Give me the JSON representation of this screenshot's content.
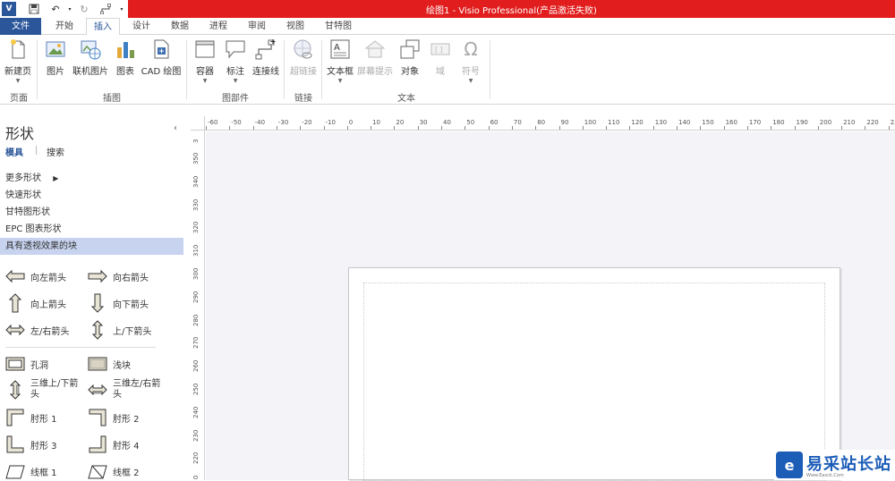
{
  "titlebar": {
    "title": "绘图1 -  Visio Professional(产品激活失败)",
    "app_icon": "V"
  },
  "tabs": [
    {
      "label": "文件"
    },
    {
      "label": "开始"
    },
    {
      "label": "插入"
    },
    {
      "label": "设计"
    },
    {
      "label": "数据"
    },
    {
      "label": "进程"
    },
    {
      "label": "审阅"
    },
    {
      "label": "视图"
    },
    {
      "label": "甘特图"
    }
  ],
  "ribbon": {
    "buttons": [
      {
        "label": "新建页",
        "icon": "new-page-icon"
      },
      {
        "label": "图片",
        "icon": "picture-icon"
      },
      {
        "label": "联机图片",
        "icon": "online-picture-icon"
      },
      {
        "label": "图表",
        "icon": "chart-icon"
      },
      {
        "label": "CAD 绘图",
        "icon": "cad-drawing-icon"
      },
      {
        "label": "容器",
        "icon": "container-icon"
      },
      {
        "label": "标注",
        "icon": "callout-icon"
      },
      {
        "label": "连接线",
        "icon": "connector-icon"
      },
      {
        "label": "超链接",
        "icon": "hyperlink-icon"
      },
      {
        "label": "文本框",
        "icon": "textbox-icon"
      },
      {
        "label": "屏幕提示",
        "icon": "screentip-icon"
      },
      {
        "label": "对象",
        "icon": "object-icon"
      },
      {
        "label": "域",
        "icon": "field-icon"
      },
      {
        "label": "符号",
        "icon": "symbol-icon"
      }
    ],
    "groups": [
      {
        "label": "页面"
      },
      {
        "label": "插图"
      },
      {
        "label": "图部件"
      },
      {
        "label": "链接"
      },
      {
        "label": "文本"
      }
    ]
  },
  "shapes_pane": {
    "title": "形状",
    "subtabs": [
      {
        "label": "模具"
      },
      {
        "label": "搜索"
      }
    ],
    "nav": [
      {
        "label": "更多形状"
      },
      {
        "label": "快速形状"
      },
      {
        "label": "甘特图形状"
      },
      {
        "label": "EPC 图表形状"
      },
      {
        "label": "具有透视效果的块"
      }
    ],
    "shapes": [
      {
        "label": "向左箭头"
      },
      {
        "label": "向右箭头"
      },
      {
        "label": "向上箭头"
      },
      {
        "label": "向下箭头"
      },
      {
        "label": "左/右箭头"
      },
      {
        "label": "上/下箭头"
      },
      {
        "label": "孔洞"
      },
      {
        "label": "浅块"
      },
      {
        "label": "三维上/下箭头"
      },
      {
        "label": "三维左/右箭头"
      },
      {
        "label": "肘形 1"
      },
      {
        "label": "肘形 2"
      },
      {
        "label": "肘形 3"
      },
      {
        "label": "肘形 4"
      },
      {
        "label": "线框 1"
      },
      {
        "label": "线框 2"
      }
    ]
  },
  "rulers": {
    "horizontal": [
      "-60",
      "-50",
      "-40",
      "-30",
      "-20",
      "-10",
      "0",
      "10",
      "20",
      "30",
      "40",
      "50",
      "60",
      "70",
      "80",
      "90",
      "100",
      "110",
      "120",
      "130",
      "140",
      "150",
      "160",
      "170",
      "180",
      "190",
      "200",
      "210",
      "220",
      "23"
    ],
    "vertical": [
      "3",
      "350",
      "340",
      "330",
      "320",
      "310",
      "300",
      "290",
      "280",
      "270",
      "260",
      "250",
      "240",
      "230",
      "220",
      "210"
    ]
  },
  "watermark": {
    "text": "易采站长站",
    "url": "Www.Easck.Com"
  },
  "colors": {
    "title_red": "#e11d1d",
    "file_tab_blue": "#2b579a",
    "selection_blue": "#c7d3ef",
    "canvas_bg": "#f4f3f8"
  }
}
